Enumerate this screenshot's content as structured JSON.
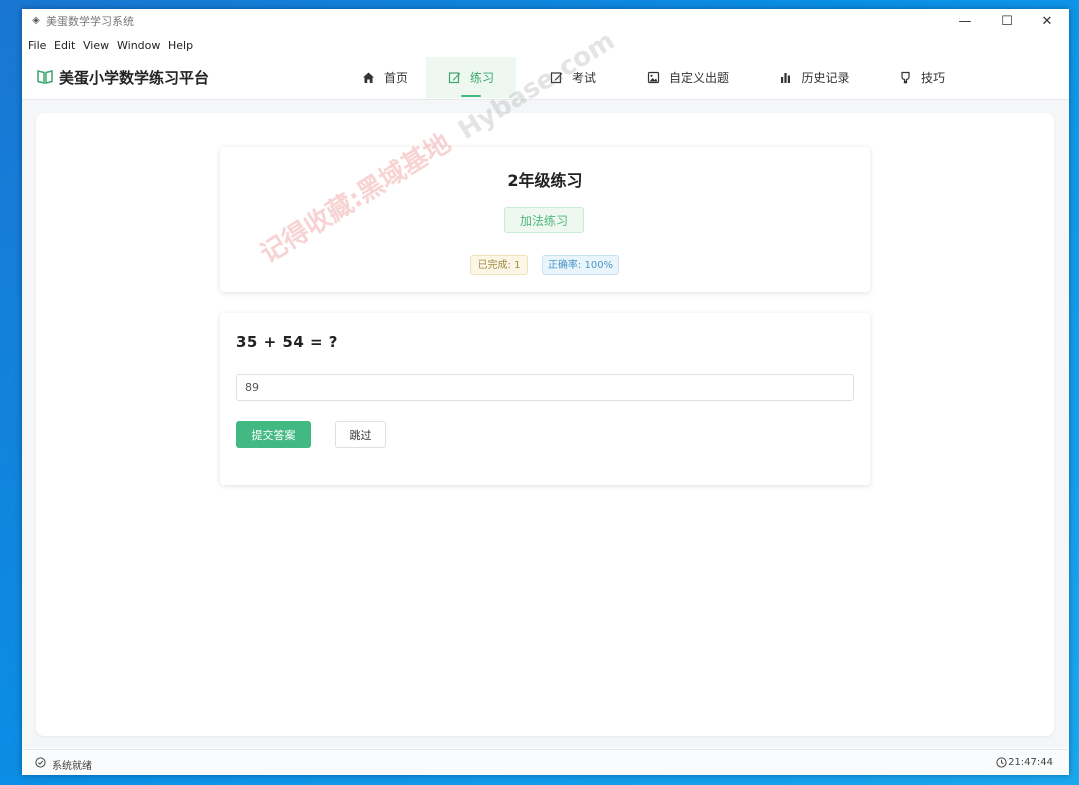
{
  "window": {
    "title": "美蛋数学学习系统",
    "controls": {
      "minimize": "—",
      "maximize": "☐",
      "close": "✕"
    }
  },
  "menu": [
    "File",
    "Edit",
    "View",
    "Window",
    "Help"
  ],
  "header": {
    "brand": "美蛋小学数学练习平台",
    "tabs": [
      {
        "label": "首页",
        "icon": "home-icon"
      },
      {
        "label": "练习",
        "icon": "edit-icon",
        "active": true
      },
      {
        "label": "考试",
        "icon": "exam-icon"
      },
      {
        "label": "自定义出题",
        "icon": "image-icon"
      },
      {
        "label": "历史记录",
        "icon": "bar-chart-icon"
      },
      {
        "label": "技巧",
        "icon": "bulb-icon"
      }
    ]
  },
  "practice": {
    "title": "2年级练习",
    "type": "加法练习",
    "completed": "已完成: 1",
    "accuracy": "正确率: 100%"
  },
  "question": {
    "text": "35 + 54 = ?",
    "answer_value": "89",
    "submit_label": "提交答案",
    "skip_label": "跳过"
  },
  "status": {
    "left": "系统就绪",
    "time": "21:47:44"
  },
  "watermark": {
    "line1": "记得收藏:黑域基地",
    "line2": "Hybase.com"
  },
  "colors": {
    "accent": "#42b983",
    "active_tab_bg": "#eef8f0"
  }
}
